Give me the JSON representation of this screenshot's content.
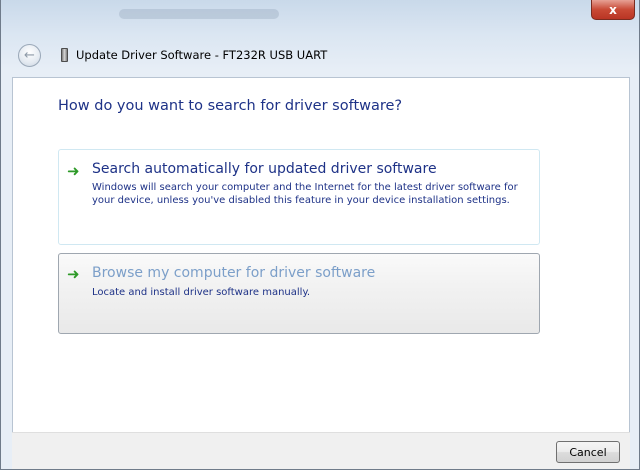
{
  "window": {
    "title": "Update Driver Software - FT232R USB UART",
    "close_glyph": "x"
  },
  "main": {
    "question": "How do you want to search for driver software?",
    "options": [
      {
        "title": "Search automatically for updated driver software",
        "description": "Windows will search your computer and the Internet for the latest driver software for your device, unless you've disabled this feature in your device installation settings.",
        "icon": "green-arrow-icon"
      },
      {
        "title": "Browse my computer for driver software",
        "description": "Locate and install driver software manually.",
        "icon": "green-arrow-icon"
      }
    ]
  },
  "footer": {
    "cancel_label": "Cancel"
  },
  "colors": {
    "link_text": "#1e3287",
    "hover_text": "#7c9fc9",
    "arrow": "#2e9a28",
    "close_button": "#c94a36"
  }
}
